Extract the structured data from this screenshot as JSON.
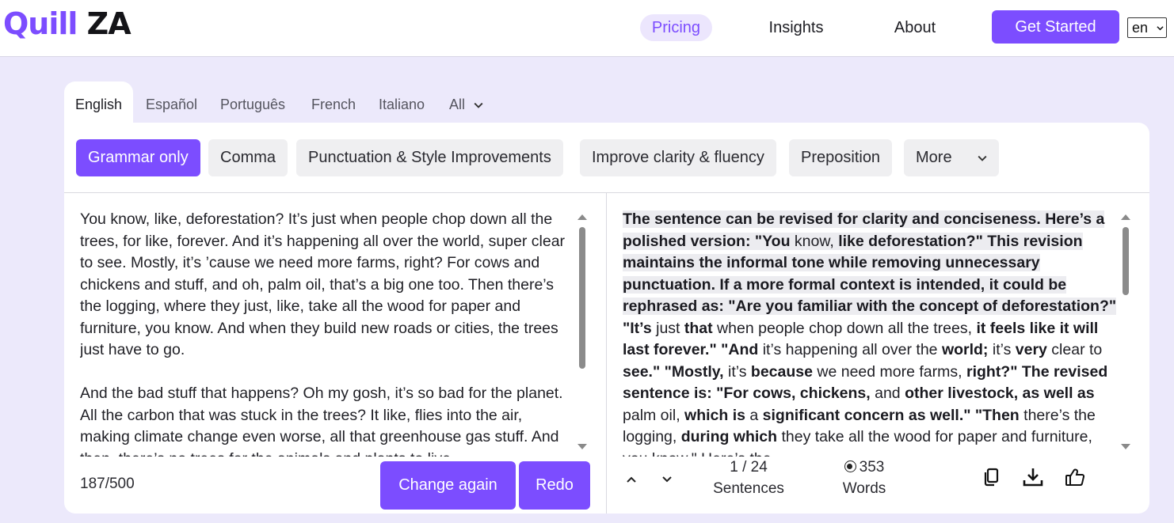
{
  "brand": {
    "part1": "Quill",
    "part2": "ZA"
  },
  "nav": {
    "pricing": "Pricing",
    "insights": "Insights",
    "about": "About",
    "cta": "Get Started",
    "language": "en"
  },
  "language_tabs": [
    "English",
    "Español",
    "Português",
    "French",
    "Italiano",
    "All"
  ],
  "modes": [
    "Grammar only",
    "Comma",
    "Punctuation & Style Improvements",
    "Improve clarity & fluency",
    "Preposition",
    "More"
  ],
  "input": {
    "paragraph1": "You know, like, deforestation? It’s just when people chop down all the trees, for like, forever. And it’s happening all over the world, super clear to see. Mostly, it’s ’cause we need more farms, right? For cows and chickens and stuff, and oh, palm oil, that’s a big one too. Then there’s the logging, where they just, like, take all the wood for paper and furniture, you know. And when they build new roads or cities, the trees just have to go.",
    "paragraph2": "And the bad stuff that happens? Oh my gosh, it’s so bad for the planet. All the carbon that was stuck in the trees? It like, flies into the air, making climate change even worse, all that greenhouse gas stuff. And then, there’s no trees for the animals and plants to live",
    "counter": "187/500"
  },
  "output": {
    "s1": "The sentence can be revised for clarity and conciseness. Here’s a polished version: \"You",
    "s2": " know, ",
    "s3": "like deforestation?\" This revision maintains the informal tone while removing unnecessary punctuation. If a more formal context is intended, it could be rephrased as: \"Are you familiar with the concept of deforestation?\"",
    "s4": " ",
    "s5": "\"It’s",
    "s6": " just ",
    "s7": "that",
    "s8": " when people chop down all the trees, ",
    "s9": "it feels like it will last forever.\" \"And",
    "s10": " it’s happening all over the ",
    "s11": "world;",
    "s12": " it’s ",
    "s13": "very",
    "s14": " clear to ",
    "s15": "see.\" \"Mostly,",
    "s16": " it’s ",
    "s17": "because",
    "s18": " we need more farms, ",
    "s19": "right?\" The revised sentence is: \"For cows, chickens,",
    "s20": " and ",
    "s21": "other livestock, as well as",
    "s22": " palm oil, ",
    "s23": "which is",
    "s24": " a ",
    "s25": "significant concern as well.\" \"Then",
    "s26": " there’s the logging, ",
    "s27": "during which",
    "s28": " they take all the wood for paper and furniture, you know.\" Here’s the"
  },
  "buttons": {
    "change_again": "Change again",
    "redo": "Redo"
  },
  "stats": {
    "sentences_value": "1 / 24",
    "sentences_label": "Sentences",
    "words_value": "353",
    "words_label": "Words"
  },
  "colors": {
    "accent": "#7c4dff",
    "page_bg": "#ece9fb"
  },
  "icons": [
    "chevron-up-icon",
    "chevron-down-icon",
    "copy-icon",
    "download-icon",
    "thumbs-up-icon",
    "radio-icon"
  ]
}
